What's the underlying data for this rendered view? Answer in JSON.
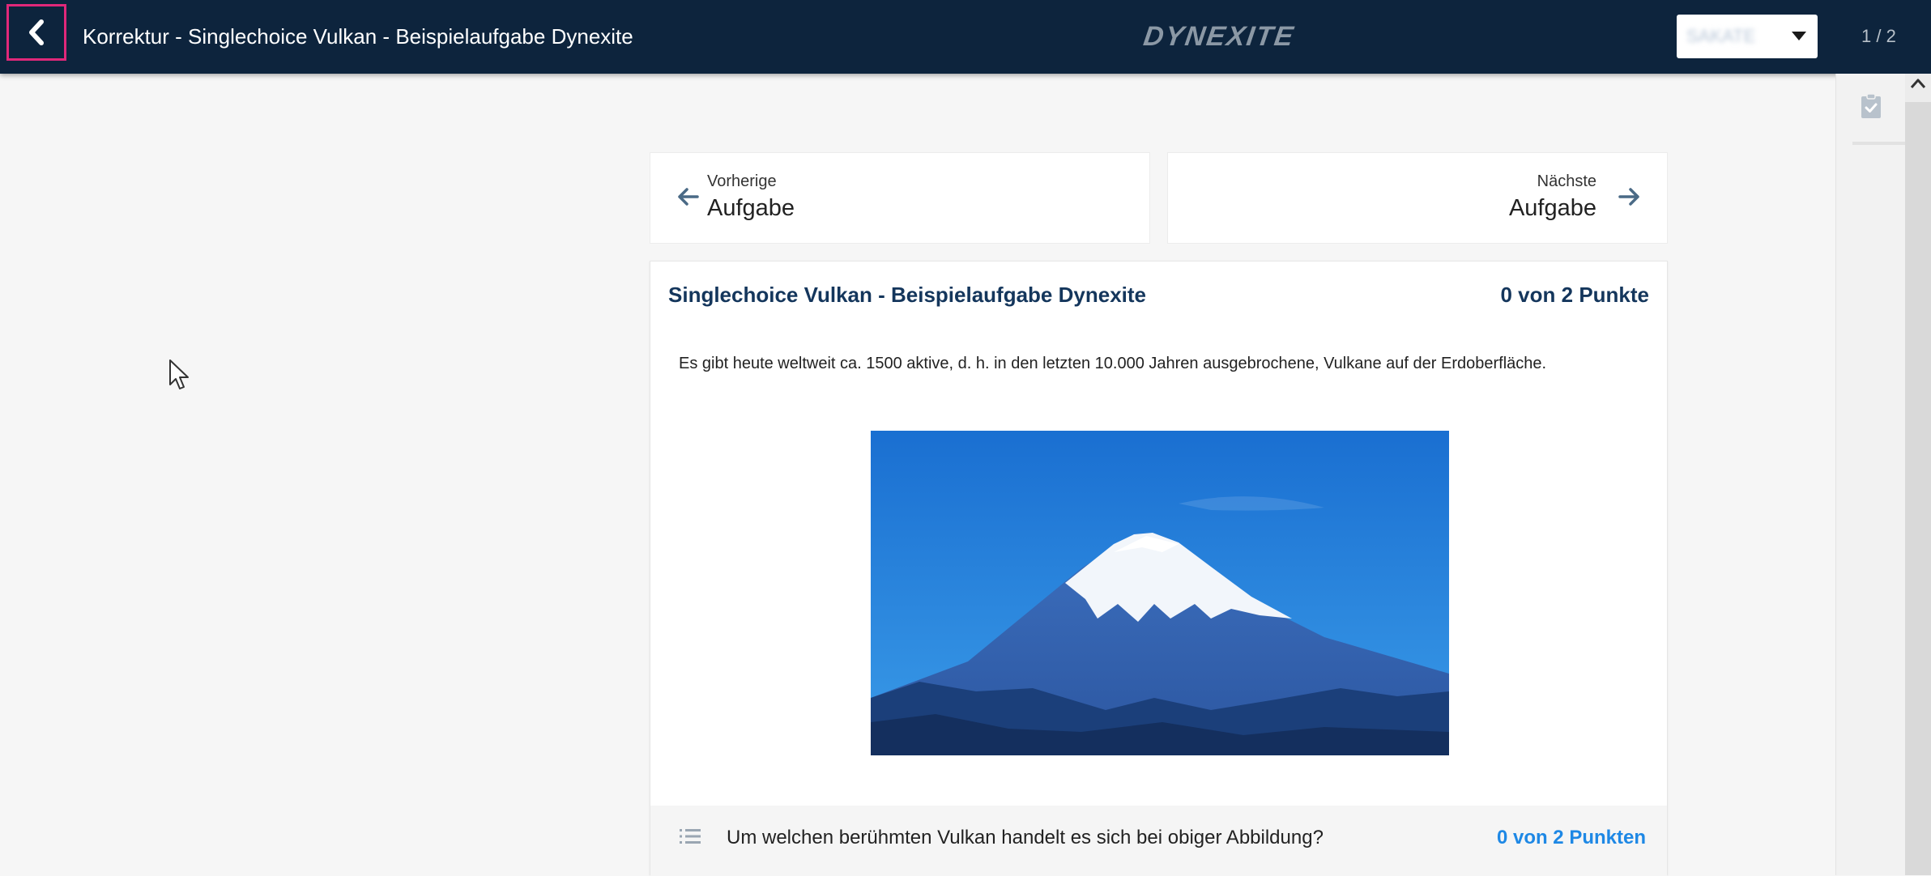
{
  "header": {
    "title": "Korrektur - Singlechoice Vulkan - Beispielaufgabe Dynexite",
    "logo_text": "DYNEXITE",
    "selector_value": "SAKATE",
    "counter": "1 / 2",
    "background_color": "#0d243d",
    "back_icon": "chevron-left-icon",
    "highlight_color": "#e0287a"
  },
  "navigation": {
    "previous": {
      "small": "Vorherige",
      "big": "Aufgabe",
      "icon": "arrow-left-icon"
    },
    "next": {
      "small": "Nächste",
      "big": "Aufgabe",
      "icon": "arrow-right-icon"
    }
  },
  "task": {
    "title": "Singlechoice Vulkan - Beispielaufgabe Dynexite",
    "points": "0 von 2 Punkte",
    "text": "Es gibt heute weltweit ca. 1500 aktive, d. h. in den letzten 10.000 Jahren ausgebrochene, Vulkane auf der Erdoberfläche.",
    "image": "volcano-photo",
    "question": {
      "text": "Um welchen berühmten Vulkan handelt es sich bei obiger Abbildung?",
      "points": "0 von 2 Punkten",
      "icon": "list-icon",
      "points_color": "#1e88e5"
    }
  },
  "side_panel": {
    "icon": "clipboard-check-icon"
  }
}
